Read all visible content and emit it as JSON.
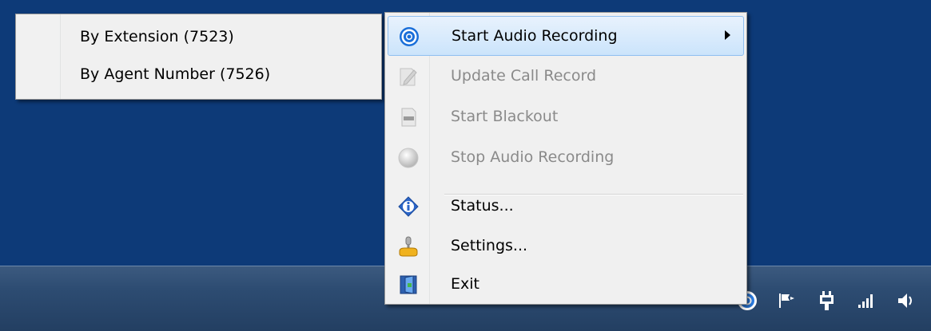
{
  "submenu": {
    "items": [
      {
        "label": "By Extension (7523)"
      },
      {
        "label": "By Agent Number (7526)"
      }
    ]
  },
  "menu": {
    "items": [
      {
        "label": "Start Audio Recording",
        "icon": "record-icon",
        "enabled": true,
        "highlighted": true,
        "has_submenu": true
      },
      {
        "label": "Update Call Record",
        "icon": "edit-document-icon",
        "enabled": false
      },
      {
        "label": "Start Blackout",
        "icon": "document-icon",
        "enabled": false
      },
      {
        "label": "Stop Audio Recording",
        "icon": "stop-circle-icon",
        "enabled": false
      },
      {
        "label": "Status...",
        "icon": "info-icon",
        "enabled": true
      },
      {
        "label": "Settings...",
        "icon": "settings-joystick-icon",
        "enabled": true
      },
      {
        "label": "Exit",
        "icon": "exit-door-icon",
        "enabled": true
      }
    ]
  },
  "tray": {
    "icons": [
      "recorder-tray-icon",
      "action-center-flag-icon",
      "power-plug-icon",
      "network-signal-icon",
      "volume-icon"
    ]
  },
  "colors": {
    "desktop": "#0d3a78",
    "menu_background": "#f0f0f0",
    "highlight": "#cbe4fb",
    "disabled_text": "#8a8a8a"
  }
}
